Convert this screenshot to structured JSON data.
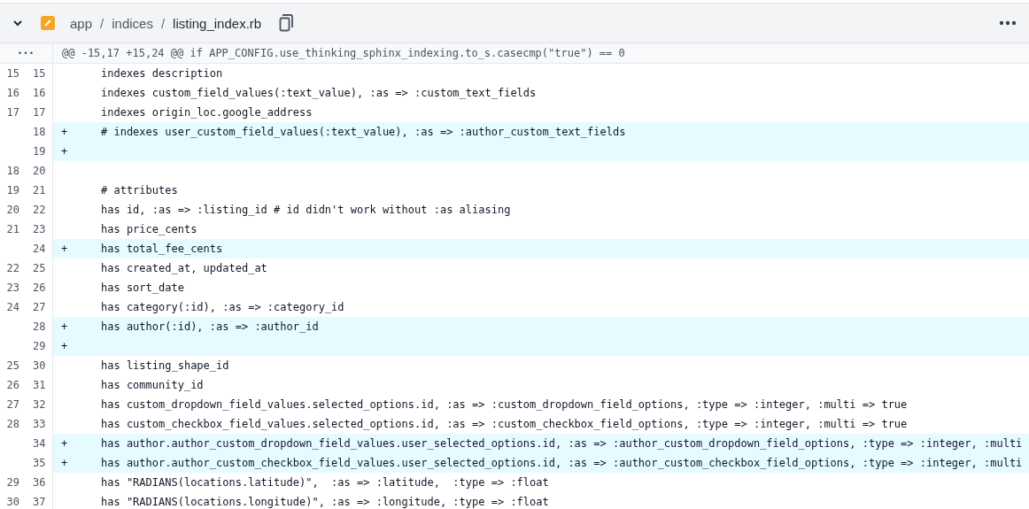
{
  "file_header": {
    "path": [
      {
        "text": "app"
      },
      {
        "text": "/"
      },
      {
        "text": "indices"
      },
      {
        "text": "/"
      },
      {
        "text": "listing_index.rb"
      }
    ],
    "expanded": true
  },
  "hunk": {
    "expander": "•••",
    "text": "@@ -15,17 +15,24 @@ if APP_CONFIG.use_thinking_sphinx_indexing.to_s.casecmp(\"true\") == 0"
  },
  "lines": [
    {
      "kind": "context",
      "old": "15",
      "new": "15",
      "text": "indexes description"
    },
    {
      "kind": "context",
      "old": "16",
      "new": "16",
      "text": "indexes custom_field_values(:text_value), :as => :custom_text_fields"
    },
    {
      "kind": "context",
      "old": "17",
      "new": "17",
      "text": "indexes origin_loc.google_address"
    },
    {
      "kind": "added",
      "new": "18",
      "marker": "+",
      "text": "# indexes user_custom_field_values(:text_value), :as => :author_custom_text_fields"
    },
    {
      "kind": "added",
      "new": "19",
      "marker": "+"
    },
    {
      "kind": "context",
      "old": "18",
      "new": "20"
    },
    {
      "kind": "context",
      "old": "19",
      "new": "21",
      "text": "# attributes"
    },
    {
      "kind": "context",
      "old": "20",
      "new": "22",
      "text": "has id, :as => :listing_id # id didn't work without :as aliasing"
    },
    {
      "kind": "context",
      "old": "21",
      "new": "23",
      "text": "has price_cents"
    },
    {
      "kind": "added",
      "new": "24",
      "marker": "+",
      "text": "has total_fee_cents"
    },
    {
      "kind": "context",
      "old": "22",
      "new": "25",
      "text": "has created_at, updated_at"
    },
    {
      "kind": "context",
      "old": "23",
      "new": "26",
      "text": "has sort_date"
    },
    {
      "kind": "context",
      "old": "24",
      "new": "27",
      "text": "has category(:id), :as => :category_id"
    },
    {
      "kind": "added",
      "new": "28",
      "marker": "+",
      "text": "has author(:id), :as => :author_id"
    },
    {
      "kind": "added",
      "new": "29",
      "marker": "+"
    },
    {
      "kind": "context",
      "old": "25",
      "new": "30",
      "text": "has listing_shape_id"
    },
    {
      "kind": "context",
      "old": "26",
      "new": "31",
      "text": "has community_id"
    },
    {
      "kind": "context",
      "old": "27",
      "new": "32",
      "text": "has custom_dropdown_field_values.selected_options.id, :as => :custom_dropdown_field_options, :type => :integer, :multi => true"
    },
    {
      "kind": "context",
      "old": "28",
      "new": "33",
      "text": "has custom_checkbox_field_values.selected_options.id, :as => :custom_checkbox_field_options, :type => :integer, :multi => true"
    },
    {
      "kind": "added",
      "new": "34",
      "marker": "+",
      "text": "has author.author_custom_dropdown_field_values.user_selected_options.id, :as => :author_custom_dropdown_field_options, :type => :integer, :multi"
    },
    {
      "kind": "added",
      "new": "35",
      "marker": "+",
      "text": "has author.author_custom_checkbox_field_values.user_selected_options.id, :as => :author_custom_checkbox_field_options, :type => :integer, :multi"
    },
    {
      "kind": "context",
      "old": "29",
      "new": "36",
      "text": "has \"RADIANS(locations.latitude)\",  :as => :latitude,  :type => :float"
    },
    {
      "kind": "context",
      "old": "30",
      "new": "37",
      "text": "has \"RADIANS(locations.longitude)\", :as => :longitude, :type => :float"
    }
  ]
}
